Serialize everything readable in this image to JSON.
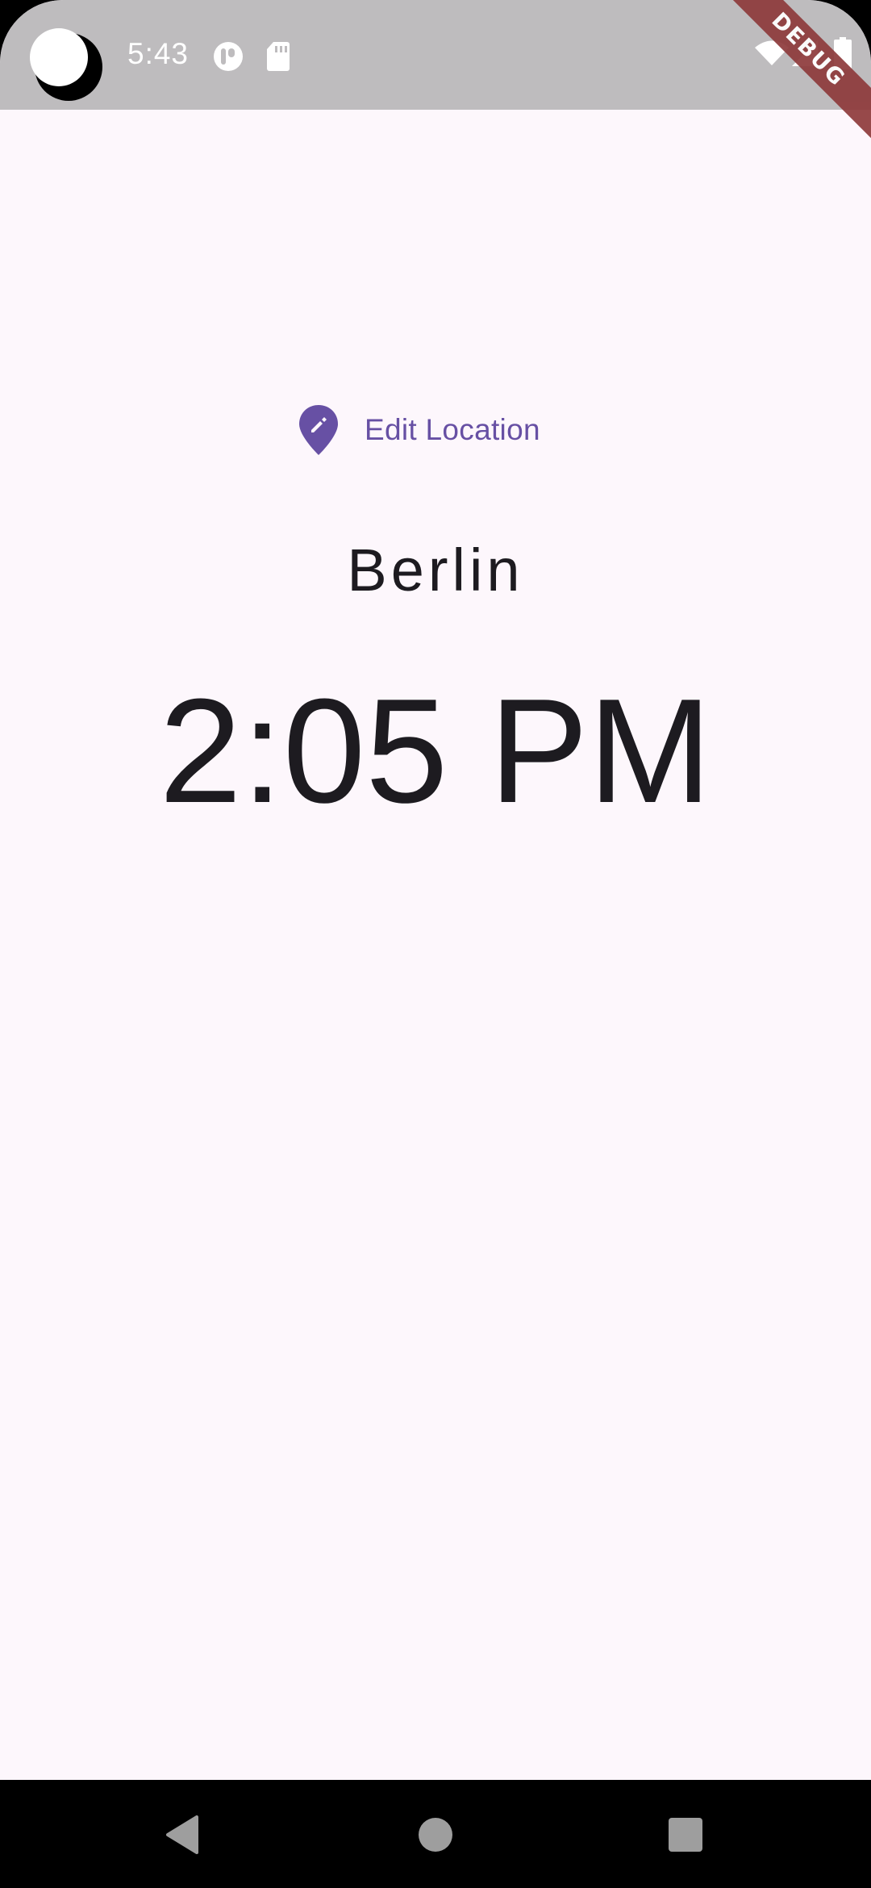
{
  "status_bar": {
    "time": "5:43",
    "icons": [
      "camera-cutout-icon",
      "app-notification-icon",
      "sd-card-icon",
      "wifi-icon",
      "cell-signal-icon",
      "battery-icon"
    ],
    "background_color": "#bebcbe"
  },
  "debug_banner": {
    "label": "DEBUG",
    "color": "#8e3a3b"
  },
  "main": {
    "edit_location_label": "Edit Location",
    "edit_location_icon": "edit-location-icon",
    "city": "Berlin",
    "time": "2:05 PM",
    "accent_color": "#6750a4",
    "background_color": "#fdf7fc"
  },
  "nav_bar": {
    "buttons": [
      "back-icon",
      "home-icon",
      "recents-icon"
    ]
  }
}
